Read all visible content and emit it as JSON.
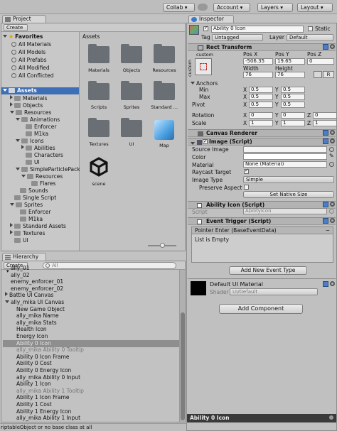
{
  "toolbar": {
    "collab": "Collab ▾",
    "cloud_icon": "cloud-icon",
    "account": "Account",
    "layers": "Layers",
    "layout": "Layout"
  },
  "project": {
    "tab_label": "Project",
    "create_label": "Create",
    "favorites_label": "Favorites",
    "favorites": [
      "All Materials",
      "All Models",
      "All Prefabs",
      "All Modified",
      "All Conflicted"
    ],
    "assets_root": "Assets",
    "tree": [
      {
        "label": "Materials",
        "indent": 1
      },
      {
        "label": "Objects",
        "indent": 1
      },
      {
        "label": "Resources",
        "indent": 1
      },
      {
        "label": "Animations",
        "indent": 2
      },
      {
        "label": "Enforcer",
        "indent": 3
      },
      {
        "label": "M1ka",
        "indent": 3
      },
      {
        "label": "Icons",
        "indent": 2
      },
      {
        "label": "Abilities",
        "indent": 3
      },
      {
        "label": "Characters",
        "indent": 3
      },
      {
        "label": "UI",
        "indent": 3
      },
      {
        "label": "SimpleParticlePack",
        "indent": 2
      },
      {
        "label": "Resources",
        "indent": 3
      },
      {
        "label": "Flares",
        "indent": 4
      },
      {
        "label": "Sounds",
        "indent": 2
      },
      {
        "label": "Single Script",
        "indent": 1
      },
      {
        "label": "Sprites",
        "indent": 1
      },
      {
        "label": "Enforcer",
        "indent": 2
      },
      {
        "label": "M1ka",
        "indent": 2
      },
      {
        "label": "Standard Assets",
        "indent": 1
      },
      {
        "label": "Textures",
        "indent": 1
      },
      {
        "label": "UI",
        "indent": 1
      }
    ],
    "grid_title": "Assets",
    "grid_items": [
      "Materials",
      "Objects",
      "Resources",
      "Scripts",
      "Sprites",
      "Standard ...",
      "Textures",
      "UI",
      "Map",
      "scene"
    ]
  },
  "hierarchy": {
    "tab_label": "Hierarchy",
    "create_label": "Create",
    "search_placeholder": "All",
    "rows": [
      {
        "label": "ally_01",
        "dim": false,
        "sel": false,
        "indent": 1
      },
      {
        "label": "ally_02",
        "dim": false,
        "sel": false,
        "indent": 1
      },
      {
        "label": "enemy_enforcer_01",
        "dim": false,
        "sel": false,
        "indent": 1
      },
      {
        "label": "enemy_enforcer_02",
        "dim": false,
        "sel": false,
        "indent": 1
      },
      {
        "label": "Battle UI Canvas",
        "dim": false,
        "sel": false,
        "indent": 0
      },
      {
        "label": "ally_mika UI Canvas",
        "dim": false,
        "sel": false,
        "indent": 0
      },
      {
        "label": "New Game Object",
        "dim": false,
        "sel": false,
        "indent": 2
      },
      {
        "label": "ally_mika Name",
        "dim": false,
        "sel": false,
        "indent": 2
      },
      {
        "label": "ally_mika Stats",
        "dim": false,
        "sel": false,
        "indent": 2
      },
      {
        "label": "Health Icon",
        "dim": false,
        "sel": false,
        "indent": 2
      },
      {
        "label": "Energy Icon",
        "dim": false,
        "sel": false,
        "indent": 2
      },
      {
        "label": "Ability 0 Icon",
        "dim": true,
        "sel": true,
        "indent": 2
      },
      {
        "label": "ally_mika Ability 0 Tooltip",
        "dim": true,
        "sel": false,
        "indent": 2
      },
      {
        "label": "Ability 0 Icon Frame",
        "dim": false,
        "sel": false,
        "indent": 2
      },
      {
        "label": "Ability 0 Cost",
        "dim": false,
        "sel": false,
        "indent": 2
      },
      {
        "label": "Ability 0 Energy Icon",
        "dim": false,
        "sel": false,
        "indent": 2
      },
      {
        "label": "ally_mika Ability 0 Input",
        "dim": false,
        "sel": false,
        "indent": 2
      },
      {
        "label": "Ability 1 Icon",
        "dim": false,
        "sel": false,
        "indent": 2
      },
      {
        "label": "ally_mika Ability 1 Tooltip",
        "dim": true,
        "sel": false,
        "indent": 2
      },
      {
        "label": "Ability 1 Icon Frame",
        "dim": false,
        "sel": false,
        "indent": 2
      },
      {
        "label": "Ability 1 Cost",
        "dim": false,
        "sel": false,
        "indent": 2
      },
      {
        "label": "Ability 1 Energy Icon",
        "dim": false,
        "sel": false,
        "indent": 2
      },
      {
        "label": "ally_mika Ability 1 Input",
        "dim": false,
        "sel": false,
        "indent": 2
      }
    ]
  },
  "inspector": {
    "tab_label": "Inspector",
    "object_name": "Ability 0 Icon",
    "static_label": "Static",
    "tag_label": "Tag",
    "tag_value": "Untagged",
    "layer_label": "Layer",
    "layer_value": "Default",
    "rect_transform": {
      "title": "Rect Transform",
      "custom": "custom",
      "anchor_side_label": "custom",
      "pos_x_label": "Pos X",
      "pos_y_label": "Pos Y",
      "pos_z_label": "Pos Z",
      "pos_x": "-506.35",
      "pos_y": "19.65",
      "pos_z": "0",
      "width_label": "Width",
      "height_label": "Height",
      "width": "76",
      "height": "76",
      "raw_label": "R",
      "anchors_label": "Anchors",
      "min_label": "Min",
      "max_label": "Max",
      "pivot_label": "Pivot",
      "min_x": "0.5",
      "min_y": "0.5",
      "max_x": "0.5",
      "max_y": "0.5",
      "pivot_x": "0.5",
      "pivot_y": "0.5",
      "rotation_label": "Rotation",
      "scale_label": "Scale",
      "rot_x": "0",
      "rot_y": "0",
      "rot_z": "0",
      "scale_x": "1",
      "scale_y": "1",
      "scale_z": "1",
      "x_label": "X",
      "y_label": "Y",
      "z_label": "Z"
    },
    "canvas_renderer": "Canvas Renderer",
    "image": {
      "title": "Image (Script)",
      "source_image_label": "Source Image",
      "source_image_value": "",
      "color_label": "Color",
      "material_label": "Material",
      "material_value": "None (Material)",
      "raycast_label": "Raycast Target",
      "image_type_label": "Image Type",
      "image_type_value": "Simple",
      "preserve_label": "Preserve Aspect",
      "native_size_label": "Set Native Size"
    },
    "ability_icon": {
      "title": "Ability Icon (Script)",
      "script_label": "Script",
      "script_value": "AbilityIcon"
    },
    "event_trigger": {
      "title": "Event Trigger (Script)",
      "entry_title": "Pointer Enter (BaseEventData)",
      "list_empty": "List is Empty",
      "add_event": "Add New Event Type",
      "remove_icon": "minus-icon"
    },
    "material_block": {
      "name": "Default UI Material",
      "shader_label": "Shader",
      "shader_value": "UI/Default"
    },
    "add_component": "Add Component",
    "preview_label": "Ability 0 Icon"
  },
  "status_bar": {
    "text": "riptableObject or no base class at all"
  }
}
